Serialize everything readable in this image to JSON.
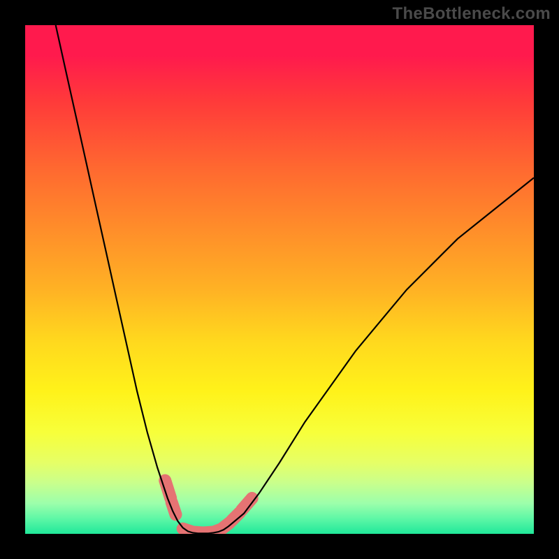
{
  "watermark": "TheBottleneck.com",
  "chart_data": {
    "type": "line",
    "title": "",
    "xlabel": "",
    "ylabel": "",
    "xlim": [
      0,
      100
    ],
    "ylim": [
      0,
      100
    ],
    "grid": false,
    "series": [
      {
        "name": "left-branch",
        "x": [
          6,
          8,
          10,
          12,
          14,
          16,
          18,
          20,
          22,
          24,
          26,
          28,
          29,
          30,
          31,
          32
        ],
        "y": [
          100,
          91,
          82,
          73,
          64,
          55,
          46,
          37,
          28,
          20,
          13,
          7,
          4.5,
          2.5,
          1.2,
          0.5
        ]
      },
      {
        "name": "bottom",
        "x": [
          32,
          33,
          34,
          35,
          36,
          37,
          38,
          39,
          40
        ],
        "y": [
          0.5,
          0.2,
          0.1,
          0.1,
          0.1,
          0.2,
          0.4,
          0.8,
          1.5
        ]
      },
      {
        "name": "right-branch",
        "x": [
          40,
          43,
          46,
          50,
          55,
          60,
          65,
          70,
          75,
          80,
          85,
          90,
          95,
          100
        ],
        "y": [
          1.5,
          4,
          8,
          14,
          22,
          29,
          36,
          42,
          48,
          53,
          58,
          62,
          66,
          70
        ]
      }
    ],
    "highlight_segments": [
      {
        "name": "left-dash-1",
        "x": [
          27.5,
          28.6
        ],
        "y": [
          10.5,
          7.0
        ]
      },
      {
        "name": "left-dash-2",
        "x": [
          28.8,
          29.6
        ],
        "y": [
          6.2,
          3.8
        ]
      },
      {
        "name": "bottom-arc",
        "x": [
          31.0,
          33.0,
          35.0,
          37.0,
          38.5
        ],
        "y": [
          1.0,
          0.35,
          0.2,
          0.35,
          0.9
        ]
      },
      {
        "name": "right-dash-1",
        "x": [
          38.8,
          40.2
        ],
        "y": [
          1.1,
          2.2
        ]
      },
      {
        "name": "right-dash-2",
        "x": [
          40.6,
          42.2
        ],
        "y": [
          2.6,
          4.2
        ]
      },
      {
        "name": "right-dash-3",
        "x": [
          42.6,
          44.6
        ],
        "y": [
          4.7,
          7.0
        ]
      }
    ],
    "background_gradient_top": "#ff1a4d",
    "background_gradient_bottom": "#20e89a"
  }
}
